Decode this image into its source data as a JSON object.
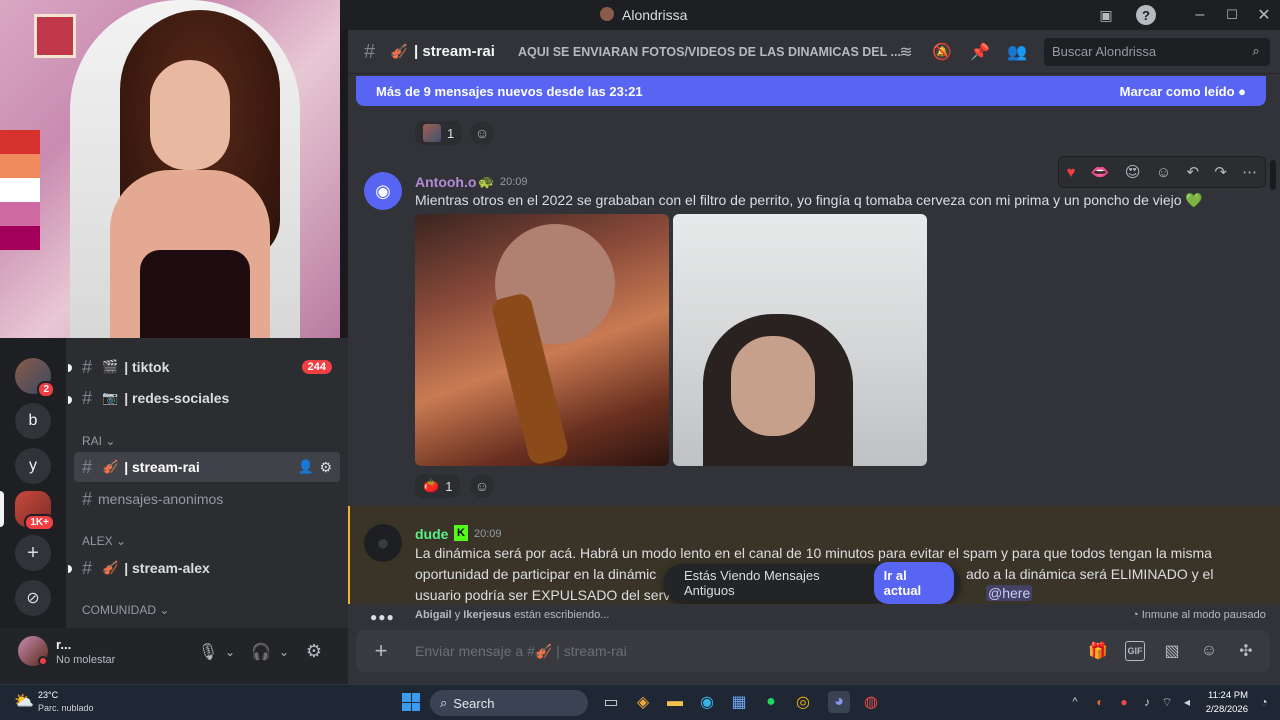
{
  "window": {
    "title": "Alondrissa"
  },
  "channel_header": {
    "name": "stream-rai",
    "emoji": "🎻",
    "topic": "AQUI SE ENVIARAN FOTOS/VIDEOS DE LAS DINAMICAS DEL ...",
    "search_placeholder": "Buscar Alondrissa"
  },
  "new_messages_bar": {
    "text": "Más de 9 mensajes nuevos desde las 23:21",
    "action": "Marcar como leído"
  },
  "messages": [
    {
      "author": "Antooh.o",
      "author_tag": "🐢",
      "time": "20:09",
      "author_color": "#b38bd6",
      "text": "Mientras otros en el 2022 se grababan con el filtro de perrito, yo fingía q tomaba cerveza con mi prima y un poncho de viejo 💚",
      "reaction_count": "1",
      "reaction_emoji": "🍅"
    },
    {
      "author": "dude",
      "author_tag": "K",
      "time": "20:09",
      "author_color": "#57f287",
      "text_line1": "La dinámica será por acá. Habrá un modo lento en el canal de 10 minutos para evitar el spam y para que todos tengan la misma",
      "text_line2_start": "oportunidad de participar en la dinámic",
      "text_line2_end": "ado a la dinámica será ELIMINADO y el",
      "text_line3_start": "usuario podría ser EXPULSADO del serv",
      "mention": "@here"
    }
  ],
  "prev_reaction_count": "1",
  "toast": {
    "text": "Estás Viendo Mensajes Antiguos",
    "button": "Ir al actual"
  },
  "typing": {
    "user1": "Abigail",
    "conj": "y",
    "user2": "Ikerjesus",
    "suffix": "están escribiendo..."
  },
  "slowmode": "Inmune al modo pausado",
  "composer": {
    "placeholder": "Enviar mensaje a #🎻 | stream-rai"
  },
  "sidebar": {
    "servers": [
      {
        "label": "",
        "badge": "2"
      },
      {
        "label": "b",
        "badge": ""
      },
      {
        "label": "y",
        "badge": ""
      },
      {
        "label": "",
        "badge": "1K+"
      }
    ],
    "channels_top": [
      {
        "emoji": "🎬",
        "name": "tiktok",
        "count": "244"
      },
      {
        "emoji": "📷",
        "name": "redes-sociales",
        "count": ""
      }
    ],
    "category_rai": "RAI",
    "rai_channels": [
      {
        "emoji": "🎻",
        "name": "stream-rai"
      },
      {
        "emoji": "",
        "name": "mensajes-anonimos"
      }
    ],
    "category_alex": "ALEX",
    "alex_channels": [
      {
        "emoji": "🎻",
        "name": "stream-alex"
      }
    ],
    "category_comunidad": "COMUNIDAD"
  },
  "user": {
    "name": "r...",
    "status": "No molestar"
  },
  "taskbar": {
    "weather_temp": "23°C",
    "weather_desc": "Parc. nublado",
    "search": "Search",
    "time": "11:24 PM",
    "date": "2/28/2026"
  }
}
